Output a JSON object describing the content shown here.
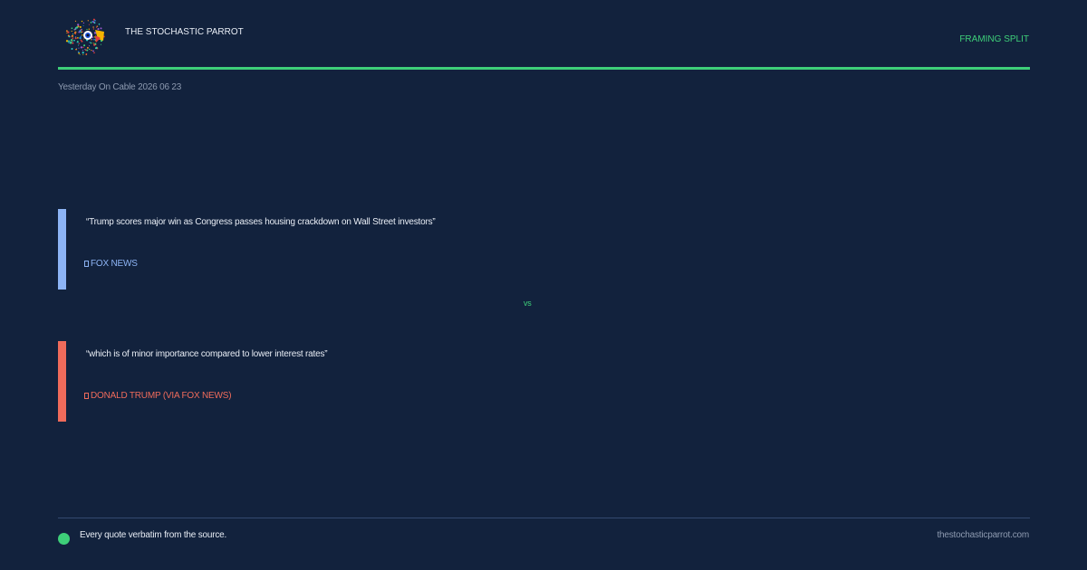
{
  "header": {
    "brand": "THE STOCHASTIC PARROT",
    "tag": "FRAMING SPLIT",
    "subtitle": "Yesterday On Cable 2026 06 23",
    "logo_icon": "parrot-logo-icon"
  },
  "quotes": [
    {
      "text": "“Trump scores major win as Congress passes housing crackdown on Wall Street investors”",
      "source": "FOX NEWS",
      "accent": "#8db4f5"
    },
    {
      "text": "“which is of minor importance compared to lower interest rates”",
      "source": "DONALD TRUMP (VIA FOX NEWS)",
      "accent": "#ef6b5b"
    }
  ],
  "divider_label": "vs",
  "footer": {
    "note": "Every quote verbatim from the source.",
    "site": "thestochasticparrot.com"
  },
  "colors": {
    "background": "#12223d",
    "accent_green": "#3ecf79",
    "muted": "#8d9ab0",
    "text": "#e8edf5"
  }
}
